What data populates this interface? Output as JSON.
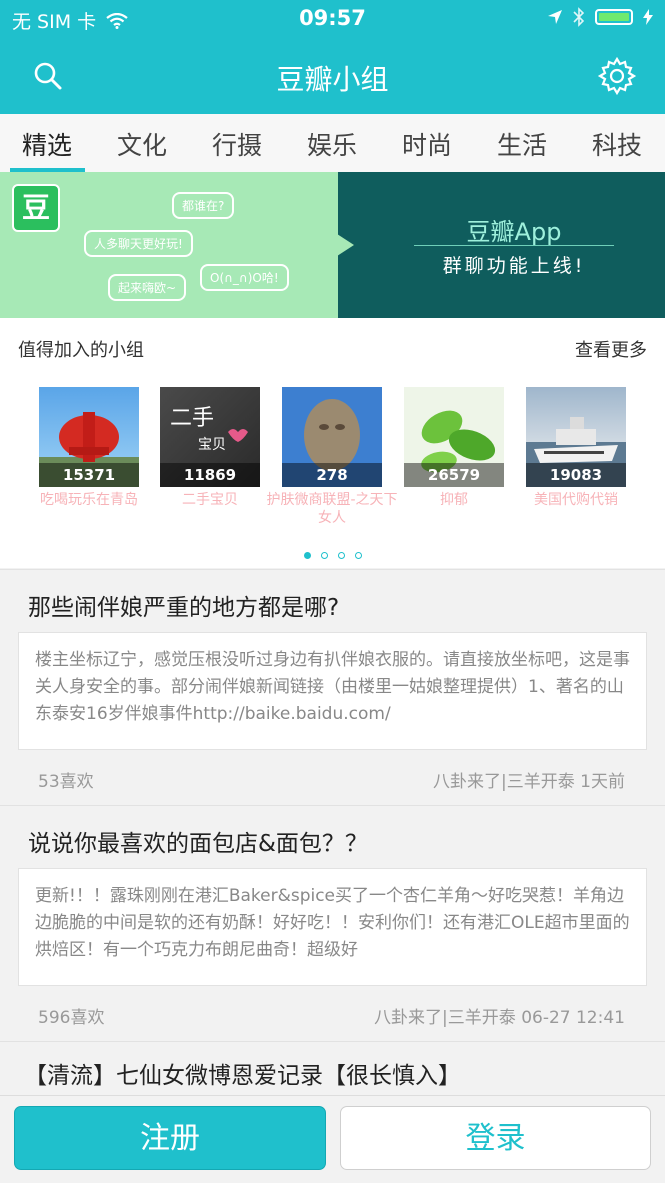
{
  "status": {
    "carrier": "无 SIM 卡",
    "time": "09:57"
  },
  "nav": {
    "title": "豆瓣小组"
  },
  "tabs": [
    "精选",
    "文化",
    "行摄",
    "娱乐",
    "时尚",
    "生活",
    "科技"
  ],
  "banner": {
    "logo": "豆",
    "bubbles": [
      "都谁在?",
      "人多聊天更好玩!",
      "起来嗨欧~",
      "O(∩_∩)O哈!"
    ],
    "app_title": "豆瓣App",
    "app_sub": "群聊功能上线!"
  },
  "groups": {
    "heading": "值得加入的小组",
    "more": "查看更多",
    "items": [
      {
        "count": "15371",
        "name": "吃喝玩乐在青岛"
      },
      {
        "count": "11869",
        "name": "二手宝贝"
      },
      {
        "count": "278",
        "name": "护肤微商联盟-之天下女人"
      },
      {
        "count": "26579",
        "name": "抑郁"
      },
      {
        "count": "19083",
        "name": "美国代购代销"
      }
    ]
  },
  "posts": [
    {
      "title": "那些闹伴娘严重的地方都是哪?",
      "excerpt": "楼主坐标辽宁，感觉压根没听过身边有扒伴娘衣服的。请直接放坐标吧，这是事关人身安全的事。部分闹伴娘新闻链接（由楼里一姑娘整理提供）1、著名的山东泰安16岁伴娘事件http://baike.baidu.com/",
      "likes": "53喜欢",
      "meta": "八卦来了|三羊开泰 1天前"
    },
    {
      "title": "说说你最喜欢的面包店&面包？？",
      "excerpt": "更新!！！露珠刚刚在港汇Baker&spice买了一个杏仁羊角～好吃哭惹！羊角边边脆脆的中间是软的还有奶酥！好好吃！！安利你们！还有港汇OLE超市里面的烘焙区！有一个巧克力布朗尼曲奇！超级好",
      "likes": "596喜欢",
      "meta": "八卦来了|三羊开泰 06-27 12:41"
    },
    {
      "title": "【清流】七仙女微博恩爱记录【很长慎入】"
    }
  ],
  "buttons": {
    "register": "注册",
    "login": "登录"
  }
}
